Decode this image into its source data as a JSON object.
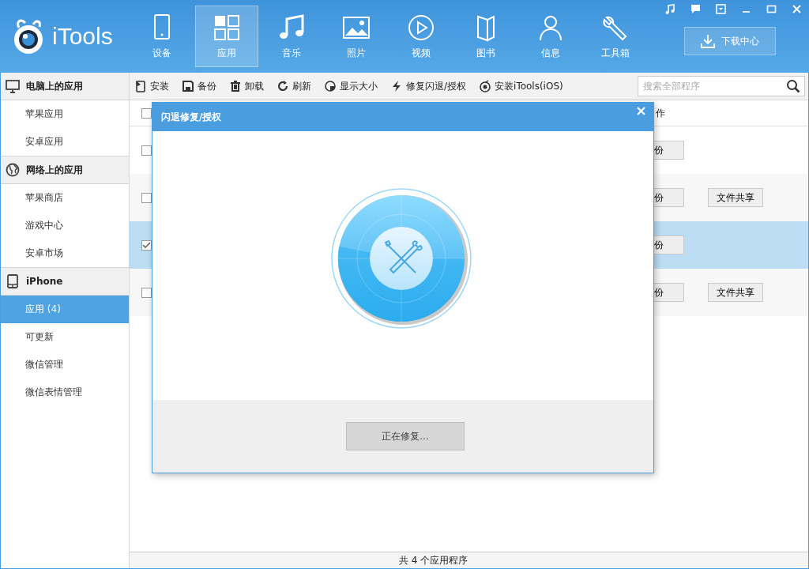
{
  "app": {
    "logo": "iTools"
  },
  "nav": [
    {
      "kind": "device",
      "label": "设备",
      "selected": false
    },
    {
      "kind": "apps",
      "label": "应用",
      "selected": true
    },
    {
      "kind": "music",
      "label": "音乐",
      "selected": false
    },
    {
      "kind": "photo",
      "label": "照片",
      "selected": false
    },
    {
      "kind": "video",
      "label": "视频",
      "selected": false
    },
    {
      "kind": "book",
      "label": "图书",
      "selected": false
    },
    {
      "kind": "message",
      "label": "信息",
      "selected": false
    },
    {
      "kind": "tools",
      "label": "工具箱",
      "selected": false
    }
  ],
  "download_button": "下载中心",
  "toolbar": [
    {
      "kind": "install",
      "label": "安装"
    },
    {
      "kind": "backup",
      "label": "备份"
    },
    {
      "kind": "uninstall",
      "label": "卸载"
    },
    {
      "kind": "refresh",
      "label": "刷新"
    },
    {
      "kind": "size",
      "label": "显示大小"
    },
    {
      "kind": "repair",
      "label": "修复闪退/授权"
    },
    {
      "kind": "itools",
      "label": "安装iTools(iOS)"
    }
  ],
  "search": {
    "placeholder": "搜索全部程序"
  },
  "sidebar": [
    {
      "kind": "computer",
      "title": "电脑上的应用",
      "items": [
        {
          "label": "苹果应用",
          "selected": false
        },
        {
          "label": "安卓应用",
          "selected": false
        }
      ]
    },
    {
      "kind": "globe",
      "title": "网络上的应用",
      "items": [
        {
          "label": "苹果商店",
          "selected": false
        },
        {
          "label": "游戏中心",
          "selected": false
        },
        {
          "label": "安卓市场",
          "selected": false
        }
      ]
    },
    {
      "kind": "phone",
      "title": "iPhone",
      "items": [
        {
          "label": "应用 (4)",
          "selected": true
        },
        {
          "label": "可更新",
          "selected": false
        },
        {
          "label": "微信管理",
          "selected": false
        },
        {
          "label": "微信表情管理",
          "selected": false
        }
      ]
    }
  ],
  "table": {
    "header": {
      "checked": false,
      "column_2": "作"
    },
    "rows": [
      {
        "checked": false,
        "selected": false,
        "buttons": [
          "份"
        ]
      },
      {
        "checked": false,
        "selected": false,
        "buttons": [
          "份",
          "文件共享"
        ]
      },
      {
        "checked": true,
        "selected": true,
        "buttons": [
          "份"
        ]
      },
      {
        "checked": false,
        "selected": false,
        "buttons": [
          "份",
          "文件共享"
        ]
      }
    ]
  },
  "dialog": {
    "title": "闪退修复/授权",
    "button": "正在修复..."
  },
  "status_bar": "共 4 个应用程序"
}
